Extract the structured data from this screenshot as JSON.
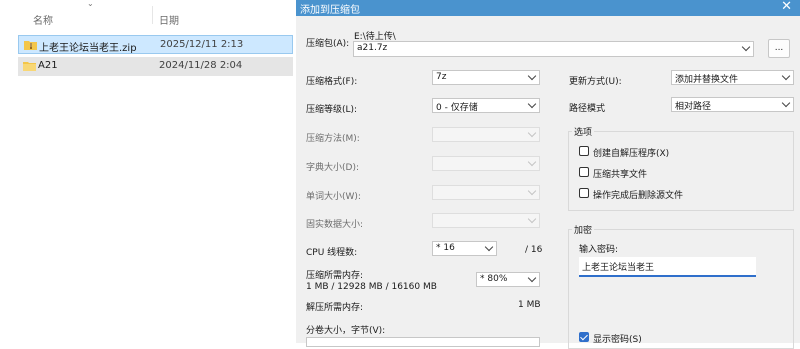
{
  "explorer": {
    "col_name": "名称",
    "col_date": "日期",
    "files": [
      {
        "name": "上老王论坛当老王.zip",
        "date": "2025/12/11 2:13",
        "icon": "zip-folder-icon",
        "state": "selected"
      },
      {
        "name": "A21",
        "date": "2024/11/28 2:04",
        "icon": "folder-icon",
        "state": "hover"
      }
    ]
  },
  "dialog": {
    "title": "添加到压缩包",
    "close_icon": "✕",
    "archive_label": "压缩包(A):",
    "archive_path": "E:\\待上传\\",
    "archive_name": "a21.7z",
    "browse_label": "...",
    "format_label": "压缩格式(F):",
    "format_value": "7z",
    "level_label": "压缩等级(L):",
    "level_value": "0 - 仅存储",
    "method_label": "压缩方法(M):",
    "dict_label": "字典大小(D):",
    "word_label": "单词大小(W):",
    "solid_label": "固实数据大小:",
    "threads_label": "CPU 线程数:",
    "threads_value": "* 16",
    "threads_max": "/ 16",
    "mem_comp_label": "压缩所需内存:",
    "mem_comp_detail": "1 MB / 12928 MB / 16160 MB",
    "mem_percent": "* 80%",
    "mem_decomp_label": "解压所需内存:",
    "mem_decomp_value": "1 MB",
    "split_label": "分卷大小，字节(V):",
    "update_label": "更新方式(U):",
    "update_value": "添加并替换文件",
    "path_label": "路径模式",
    "path_value": "相对路径",
    "options_title": "选项",
    "opt_sfx": "创建自解压程序(X)",
    "opt_shared": "压缩共享文件",
    "opt_delete": "操作完成后删除源文件",
    "encrypt_title": "加密",
    "password_label": "输入密码:",
    "password_value": "上老王论坛当老王",
    "show_password": "显示密码(S)"
  },
  "colors": {
    "titlebar": "#4a93ce",
    "selection": "#cde8ff",
    "accent": "#2f6fcb"
  }
}
